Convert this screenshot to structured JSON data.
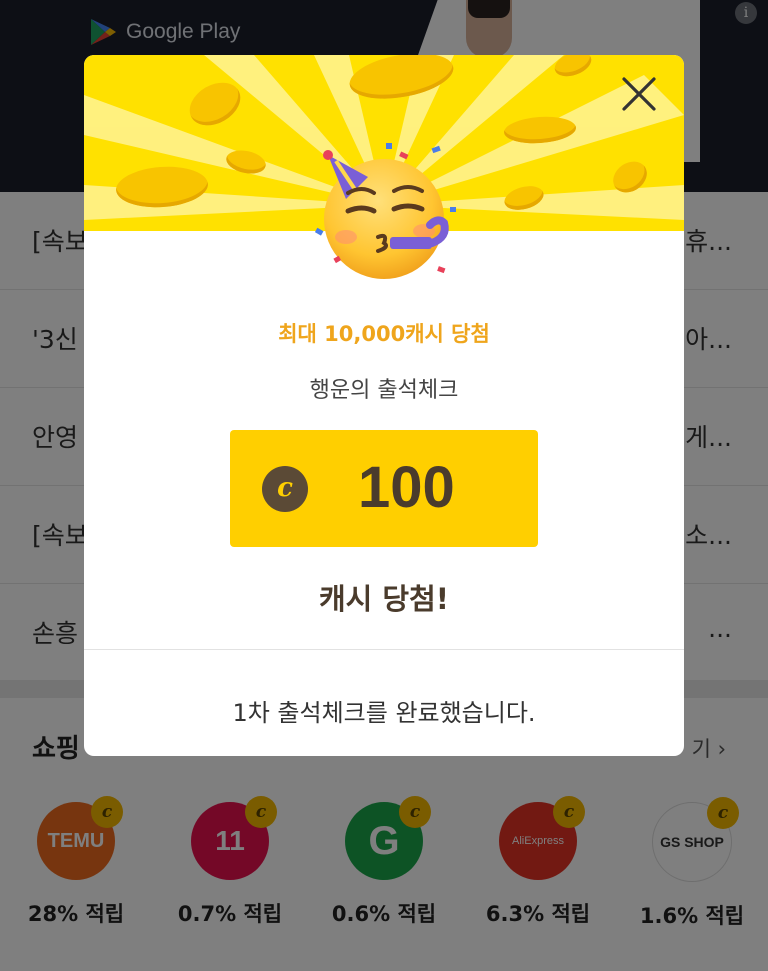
{
  "banner": {
    "store_name": "Google Play",
    "info_icon": "i"
  },
  "news": [
    {
      "left": "[속보",
      "right": "휴..."
    },
    {
      "left": "'3신",
      "right": "아..."
    },
    {
      "left": "안영",
      "right": "게..."
    },
    {
      "left": "[속보",
      "right": "소..."
    },
    {
      "left": "손흥",
      "right": "..."
    }
  ],
  "shopping": {
    "title": "쇼핑",
    "more_label": "기 ›",
    "items": [
      {
        "name": "TEMU",
        "rate": "28% 적립",
        "color": "#ee6a1e"
      },
      {
        "name": "11",
        "rate": "0.7% 적립",
        "color": "#e8114f"
      },
      {
        "name": "G",
        "rate": "0.6% 적립",
        "color": "#1aa64a"
      },
      {
        "name": "AliExpress",
        "rate": "6.3% 적립",
        "color": "#e43225"
      },
      {
        "name": "GS SHOP",
        "rate": "1.6% 적립",
        "color": "#ffffff"
      }
    ],
    "badge_symbol": "c"
  },
  "modal": {
    "subtitle": "최대 10,000캐시 당첨",
    "title": "행운의 출석체크",
    "cash_symbol": "c",
    "cash_amount": "100",
    "result": "캐시 당첨!",
    "message": "1차 출석체크를 완료했습니다.",
    "colors": {
      "header_yellow": "#ffe100",
      "box_yellow": "#ffcf00",
      "accent_orange": "#efa51c",
      "dark_brown": "#4a3b2c"
    }
  }
}
